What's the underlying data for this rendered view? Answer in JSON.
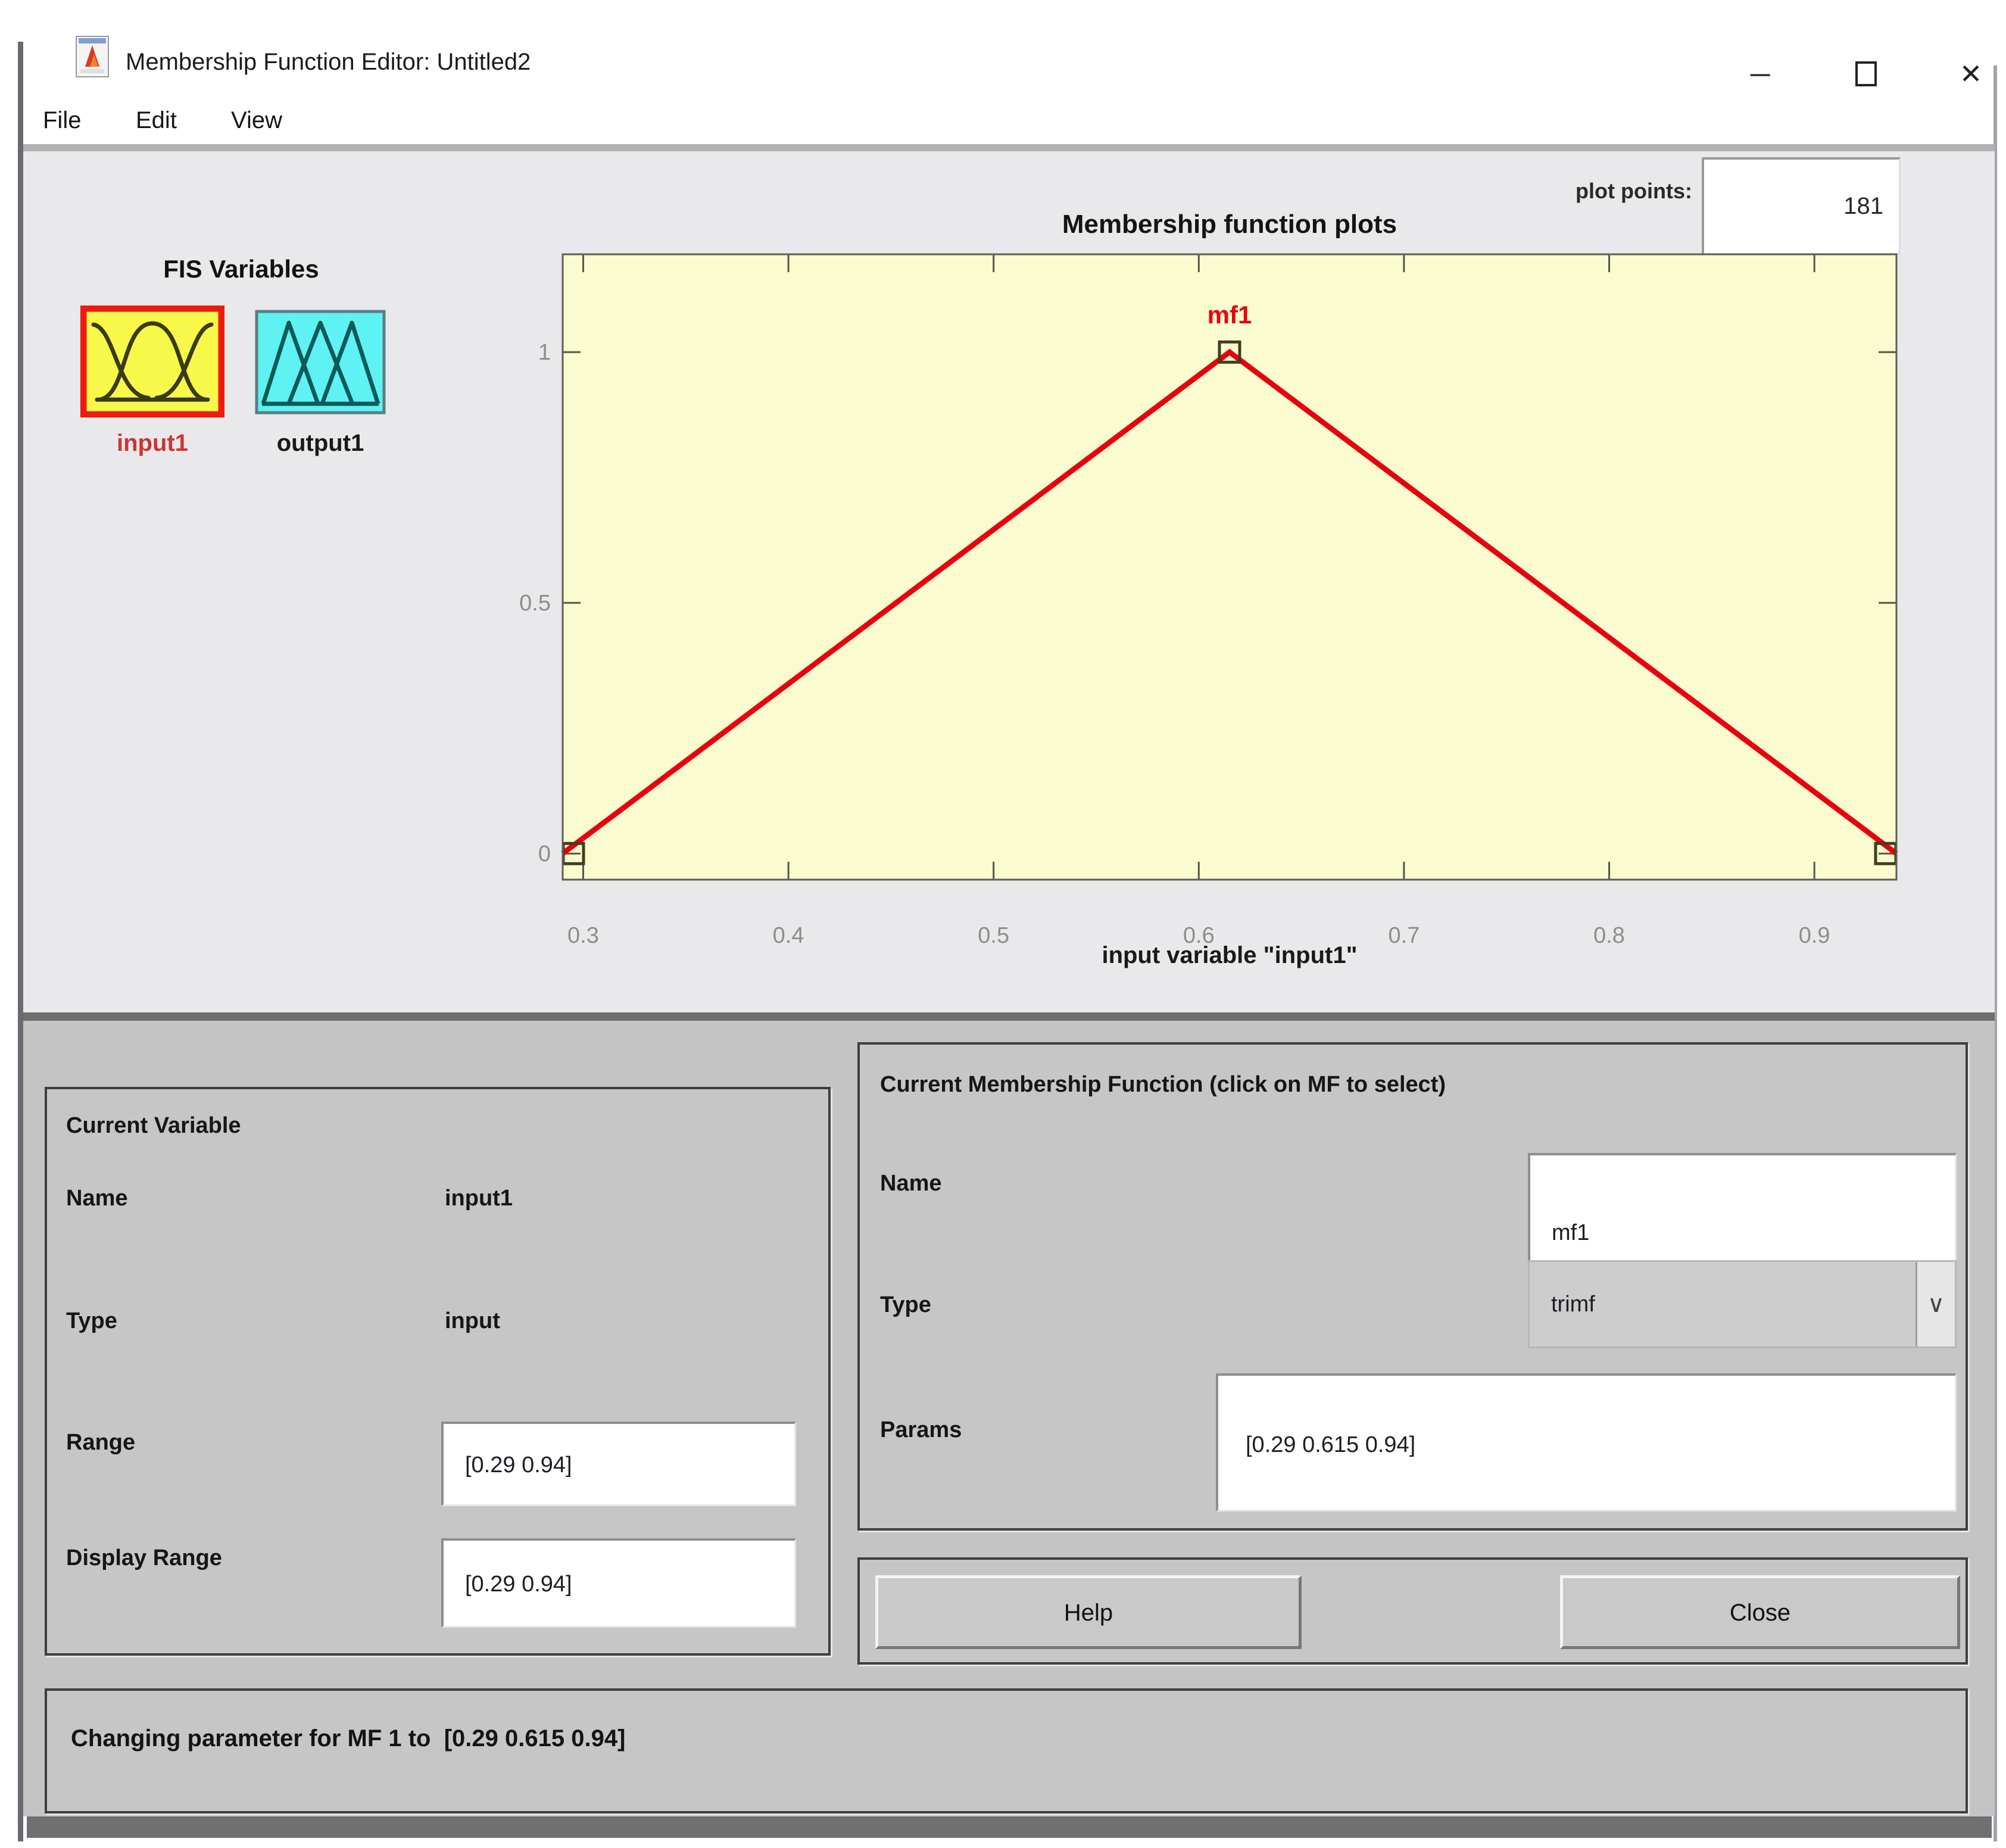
{
  "window": {
    "title": "Membership Function Editor: Untitled2",
    "icons": {
      "minimize": "─",
      "close": "✕",
      "dropdown": "∨"
    }
  },
  "menu": {
    "file": "File",
    "edit": "Edit",
    "view": "View"
  },
  "plot_points": {
    "label": "plot points:",
    "value": "181"
  },
  "fis_variables": {
    "title": "FIS Variables",
    "input_label": "input1",
    "output_label": "output1"
  },
  "plot": {
    "type": "line",
    "title": "Membership function plots",
    "series_label": "mf1",
    "points": [
      [
        0.29,
        0
      ],
      [
        0.615,
        1
      ],
      [
        0.94,
        0
      ]
    ],
    "xlim": [
      0.29,
      0.94
    ],
    "ylim": [
      -0.052,
      1.195
    ],
    "x_ticks": [
      "0.3",
      "0.4",
      "0.5",
      "0.6",
      "0.7",
      "0.8",
      "0.9"
    ],
    "y_ticks": [
      "0",
      "0.5",
      "1"
    ],
    "xlabel": "input variable \"input1\"",
    "line_color": "#e8000f",
    "background": "#fbfbd0",
    "grid": "off"
  },
  "current_variable": {
    "title": "Current Variable",
    "name_label": "Name",
    "name_value": "input1",
    "type_label": "Type",
    "type_value": "input",
    "range_label": "Range",
    "range_value": "[0.29 0.94]",
    "display_range_label": "Display Range",
    "display_range_value": "[0.29 0.94]"
  },
  "current_mf": {
    "title": "Current Membership Function (click on MF to select)",
    "name_label": "Name",
    "name_value": "mf1",
    "type_label": "Type",
    "type_value": "trimf",
    "params_label": "Params",
    "params_value": "[0.29 0.615 0.94]"
  },
  "buttons": {
    "help": "Help",
    "close": "Close"
  },
  "status": {
    "message": "Changing parameter for MF 1 to  [0.29 0.615 0.94]"
  },
  "colors": {
    "accent_red": "#e8000f",
    "plot_bg": "#fbfbd0",
    "input_icon_bg": "#f8f84a",
    "output_icon_bg": "#5ef2f2",
    "panel_bg": "#c6c6c6",
    "content_bg": "#e9e9eb"
  }
}
